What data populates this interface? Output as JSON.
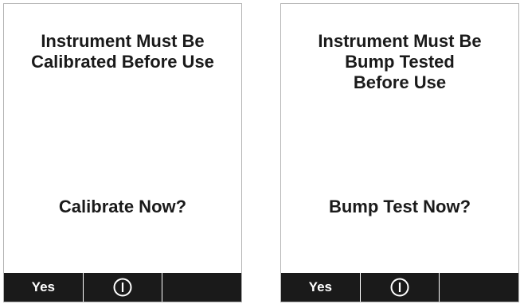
{
  "screens": [
    {
      "message_lines": [
        "Instrument Must Be",
        "Calibrated Before Use"
      ],
      "question": "Calibrate Now?",
      "softkeys": {
        "left": "Yes",
        "center_icon": "power-icon",
        "right": ""
      }
    },
    {
      "message_lines": [
        "Instrument Must Be",
        "Bump Tested",
        "Before Use"
      ],
      "question": "Bump Test Now?",
      "softkeys": {
        "left": "Yes",
        "center_icon": "power-icon",
        "right": ""
      }
    }
  ],
  "colors": {
    "softkey_bar": "#1a1a1a",
    "text": "#1a1a1a",
    "background": "#ffffff"
  }
}
